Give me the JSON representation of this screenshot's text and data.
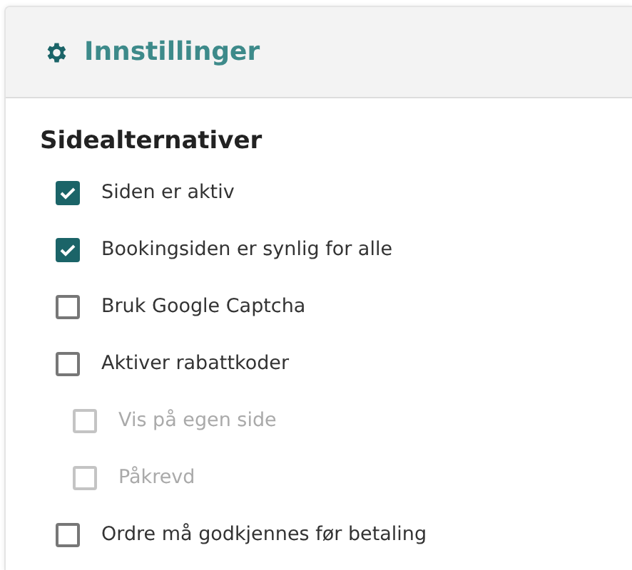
{
  "header": {
    "title": "Innstillinger"
  },
  "section": {
    "heading": "Sidealternativer"
  },
  "options": [
    {
      "label": "Siden er aktiv",
      "checked": true,
      "disabled": false
    },
    {
      "label": "Bookingsiden er synlig for alle",
      "checked": true,
      "disabled": false
    },
    {
      "label": "Bruk Google Captcha",
      "checked": false,
      "disabled": false
    },
    {
      "label": "Aktiver rabattkoder",
      "checked": false,
      "disabled": false,
      "children": [
        {
          "label": "Vis på egen side",
          "checked": false,
          "disabled": true
        },
        {
          "label": "Påkrevd",
          "checked": false,
          "disabled": true
        }
      ]
    },
    {
      "label": "Ordre må godkjennes før betaling",
      "checked": false,
      "disabled": false
    }
  ]
}
